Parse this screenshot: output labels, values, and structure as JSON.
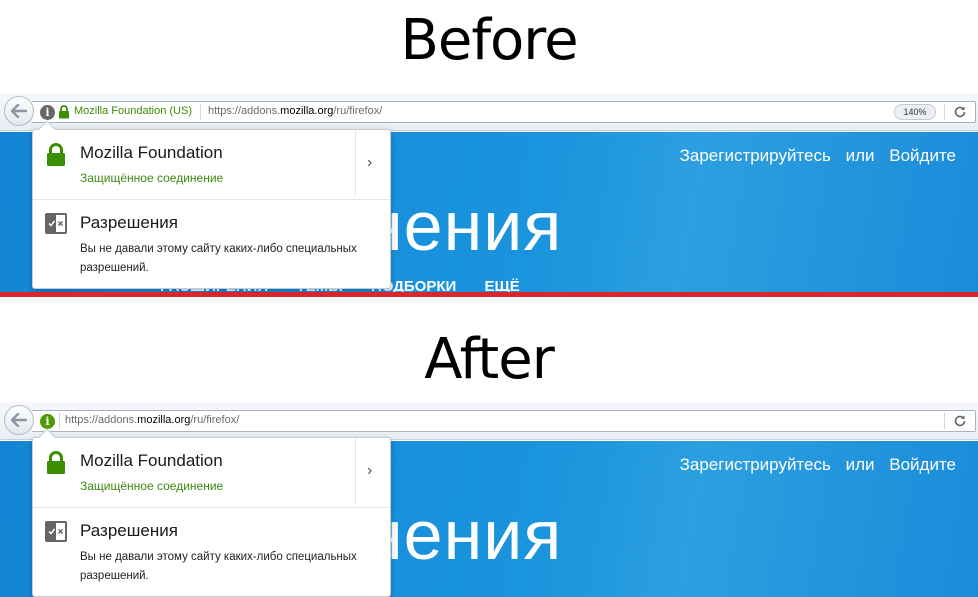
{
  "before": {
    "caption": "Before",
    "identity_label": "Mozilla Foundation (US)",
    "url": {
      "prefix": "https://addons.",
      "domain": "mozilla.org",
      "path": "/ru/firefox/"
    },
    "zoom": "140%",
    "site": {
      "register": "Зарегистрируйтесь",
      "or": "или",
      "login": "Войдите",
      "big_text": "нения",
      "menu": [
        "РАСШИРЕНИЯ",
        "ТЕМЫ",
        "ПОДБОРКИ",
        "ЕЩЁ"
      ]
    },
    "popup": {
      "title": "Mozilla Foundation",
      "subtitle": "Защищённое соединение",
      "permissions_title": "Разрешения",
      "permissions_text": "Вы не давали этому сайту каких-либо специальных разрешений."
    }
  },
  "after": {
    "caption": "After",
    "url": {
      "prefix": "https://addons.",
      "domain": "mozilla.org",
      "path": "/ru/firefox/"
    },
    "site": {
      "register": "Зарегистрируйтесь",
      "or": "или",
      "login": "Войдите",
      "big_text": "нения"
    },
    "popup": {
      "title": "Mozilla Foundation",
      "subtitle": "Защищённое соединение",
      "permissions_title": "Разрешения",
      "permissions_text": "Вы не давали этому сайту каких-либо специальных разрешений."
    }
  },
  "colors": {
    "secure_green": "#3a8e00",
    "site_blue": "#1a94dd",
    "divider_red": "#d9262e"
  },
  "icons": [
    "back-arrow-icon",
    "info-icon",
    "lock-icon",
    "reload-icon",
    "chevron-right-icon",
    "permissions-icon"
  ]
}
